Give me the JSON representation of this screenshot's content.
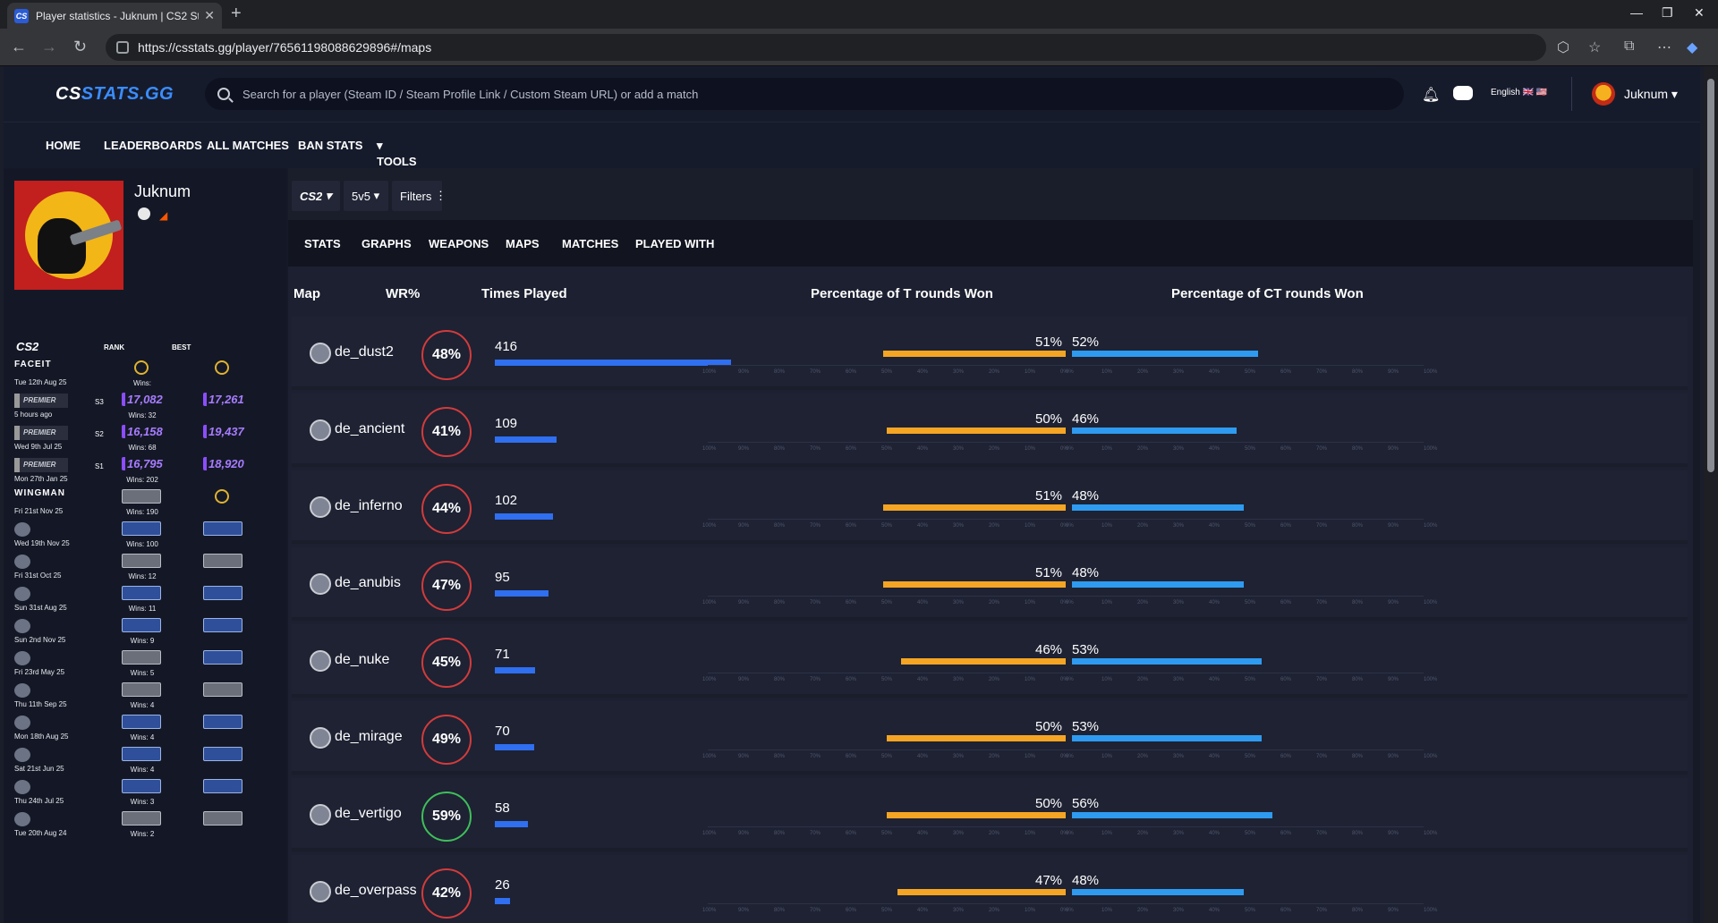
{
  "browser": {
    "tab_title": "Player statistics - Juknum | CS2 St",
    "tab_favicon": "CS",
    "url": "https://csstats.gg/player/76561198088629896#/maps"
  },
  "site": {
    "logo_cs": "CS",
    "logo_stats": "STATS.GG",
    "search_placeholder": "Search for a player (Steam ID / Steam Profile Link / Custom Steam URL) or add a match",
    "language": "English 🇬🇧 🇺🇸",
    "username": "Juknum",
    "nav": [
      "HOME",
      "LEADERBOARDS",
      "ALL MATCHES",
      "BAN STATS",
      "TOOLS"
    ]
  },
  "profile": {
    "name": "Juknum",
    "game_label": "CS2",
    "rank_header": "RANK",
    "best_header": "BEST",
    "ranks": [
      {
        "group": "FACEIT",
        "date": "Tue 12th Aug 25",
        "wins": "Wins:",
        "season": "",
        "rank": "",
        "best": ""
      },
      {
        "group": "PREMIER",
        "date": "5 hours ago",
        "wins": "Wins: 32",
        "season": "S3",
        "rank": "17,082",
        "best": "17,261"
      },
      {
        "group": "PREMIER",
        "date": "Wed 9th Jul 25",
        "wins": "Wins: 68",
        "season": "S2",
        "rank": "16,158",
        "best": "19,437"
      },
      {
        "group": "PREMIER",
        "date": "Mon 27th Jan 25",
        "wins": "Wins: 202",
        "season": "S1",
        "rank": "16,795",
        "best": "18,920"
      },
      {
        "group": "WINGMAN",
        "date": "Fri 21st Nov 25",
        "wins": "Wins: 190",
        "season": "",
        "rank": "",
        "best": ""
      },
      {
        "group": "",
        "date": "Wed 19th Nov 25",
        "wins": "Wins: 100",
        "season": "",
        "rank": "",
        "best": ""
      },
      {
        "group": "",
        "date": "Fri 31st Oct 25",
        "wins": "Wins: 12",
        "season": "",
        "rank": "",
        "best": ""
      },
      {
        "group": "",
        "date": "Sun 31st Aug 25",
        "wins": "Wins: 11",
        "season": "",
        "rank": "",
        "best": ""
      },
      {
        "group": "",
        "date": "Sun 2nd Nov 25",
        "wins": "Wins: 9",
        "season": "",
        "rank": "",
        "best": ""
      },
      {
        "group": "",
        "date": "Fri 23rd May 25",
        "wins": "Wins: 5",
        "season": "",
        "rank": "",
        "best": ""
      },
      {
        "group": "",
        "date": "Thu 11th Sep 25",
        "wins": "Wins: 4",
        "season": "",
        "rank": "",
        "best": ""
      },
      {
        "group": "",
        "date": "Mon 18th Aug 25",
        "wins": "Wins: 4",
        "season": "",
        "rank": "",
        "best": ""
      },
      {
        "group": "",
        "date": "Sat 21st Jun 25",
        "wins": "Wins: 4",
        "season": "",
        "rank": "",
        "best": ""
      },
      {
        "group": "",
        "date": "Thu 24th Jul 25",
        "wins": "Wins: 3",
        "season": "",
        "rank": "",
        "best": ""
      },
      {
        "group": "",
        "date": "Tue 20th Aug 24",
        "wins": "Wins: 2",
        "season": "",
        "rank": "",
        "best": ""
      }
    ]
  },
  "filters": {
    "game": "CS2",
    "mode": "5v5",
    "filters_label": "Filters"
  },
  "tabs": [
    "STATS",
    "GRAPHS",
    "WEAPONS",
    "MAPS",
    "MATCHES",
    "PLAYED WITH"
  ],
  "table": {
    "headers": {
      "map": "Map",
      "wr": "WR%",
      "played": "Times Played",
      "t": "Percentage of T rounds Won",
      "ct": "Percentage of CT rounds Won"
    },
    "tick_labels_t": [
      "100%",
      "90%",
      "80%",
      "70%",
      "60%",
      "50%",
      "40%",
      "30%",
      "20%",
      "10%",
      "0%"
    ],
    "tick_labels_ct": [
      "0%",
      "10%",
      "20%",
      "30%",
      "40%",
      "50%",
      "60%",
      "70%",
      "80%",
      "90%",
      "100%"
    ],
    "rows": [
      {
        "map": "de_dust2",
        "wr": "48%",
        "played": "416",
        "t": "51%",
        "ct": "52%"
      },
      {
        "map": "de_ancient",
        "wr": "41%",
        "played": "109",
        "t": "50%",
        "ct": "46%"
      },
      {
        "map": "de_inferno",
        "wr": "44%",
        "played": "102",
        "t": "51%",
        "ct": "48%"
      },
      {
        "map": "de_anubis",
        "wr": "47%",
        "played": "95",
        "t": "51%",
        "ct": "48%"
      },
      {
        "map": "de_nuke",
        "wr": "45%",
        "played": "71",
        "t": "46%",
        "ct": "53%"
      },
      {
        "map": "de_mirage",
        "wr": "49%",
        "played": "70",
        "t": "50%",
        "ct": "53%"
      },
      {
        "map": "de_vertigo",
        "wr": "59%",
        "played": "58",
        "t": "50%",
        "ct": "56%"
      },
      {
        "map": "de_overpass",
        "wr": "42%",
        "played": "26",
        "t": "47%",
        "ct": "48%"
      }
    ]
  },
  "colors": {
    "t_bar": "#f5a524",
    "ct_bar": "#2e9bf0",
    "played_bar": "#2f6ff0",
    "wr_ring": "#d33b3b"
  }
}
